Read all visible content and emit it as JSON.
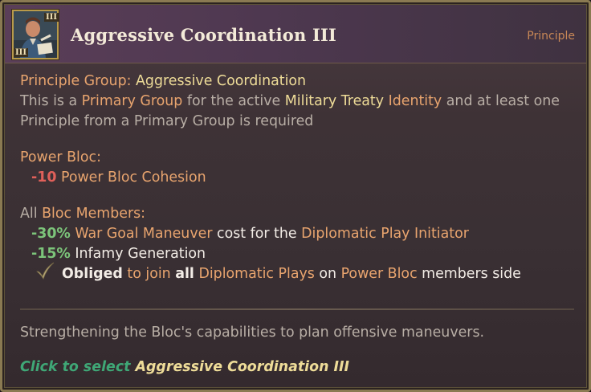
{
  "header": {
    "title": "Aggressive Coordination III",
    "category": "Principle",
    "portrait_roman": "III"
  },
  "principle_group": {
    "label": "Principle Group:",
    "value": "Aggressive Coordination"
  },
  "description": {
    "part1": "This is a ",
    "primary_group": "Primary Group",
    "part2": " for the active ",
    "military_treaty": "Military Treaty",
    "identity": "Identity",
    "part3": " and at least one",
    "line2": "Principle from a Primary Group is required"
  },
  "power_bloc": {
    "heading": "Power Bloc:",
    "value": "-10",
    "effect": "Power Bloc Cohesion"
  },
  "bloc_members": {
    "all": "All",
    "heading": "Bloc Members:",
    "effects": [
      {
        "value": "-30%",
        "text1": "War Goal Maneuver",
        "text2": " cost for the ",
        "text3": "Diplomatic Play Initiator"
      },
      {
        "value": "-15%",
        "text1": "Infamy Generation"
      }
    ],
    "obliged": {
      "w1": "Obliged",
      "w2": " to join ",
      "w3": "all",
      "w4": "Diplomatic Plays",
      "w5": " on ",
      "w6": "Power Bloc",
      "w7": " members side"
    }
  },
  "flavor": "Strengthening the Bloc's capabilities to plan offensive maneuvers.",
  "footer": {
    "action": "Click to select",
    "target": "Aggressive Coordination III"
  },
  "colors": {
    "accent_orange": "#e8a46e",
    "accent_yellow": "#eedc98",
    "negative": "#e0605a",
    "positive": "#7cc47a",
    "action_green": "#3fa776"
  }
}
